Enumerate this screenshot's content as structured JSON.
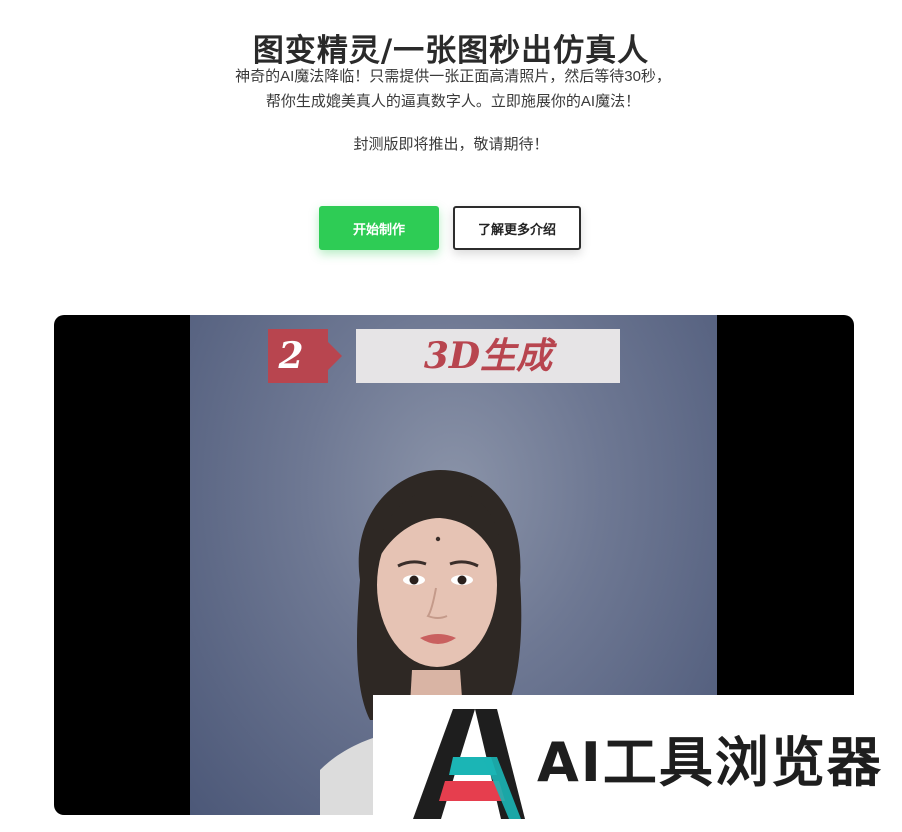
{
  "hero": {
    "title": "图变精灵/一张图秒出仿真人",
    "description": "神奇的AI魔法降临！只需提供一张正面高清照片，然后等待30秒，帮你生成媲美真人的逼真数字人。立即施展你的AI魔法！",
    "note": "封测版即将推出，敬请期待！"
  },
  "actions": {
    "start_label": "开始制作",
    "more_label": "了解更多介绍"
  },
  "video": {
    "step_number": "2",
    "step_label": "3D生成"
  },
  "watermark": {
    "text": "AI工具浏览器"
  },
  "colors": {
    "primary_green": "#2ecc55",
    "banner_red": "#b8454f",
    "logo_teal": "#1bb5b5",
    "logo_red": "#e63e4e"
  }
}
